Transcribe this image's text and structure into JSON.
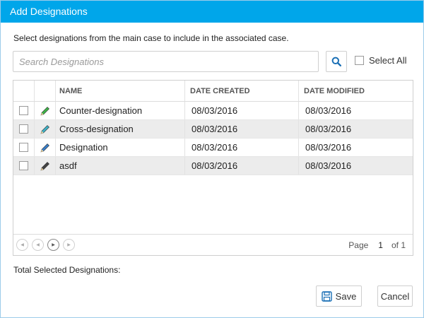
{
  "dialog": {
    "title": "Add Designations",
    "instructions": "Select designations from the main case to include in the associated case."
  },
  "search": {
    "placeholder": "Search Designations",
    "value": "",
    "button_icon": "search-icon",
    "select_all_label": "Select All",
    "select_all_checked": false
  },
  "grid": {
    "columns": [
      "NAME",
      "DATE CREATED",
      "DATE MODIFIED"
    ],
    "rows": [
      {
        "checked": false,
        "icon": "pencil-icon",
        "icon_color": "#3fb54a",
        "name": "Counter-designation",
        "created": "08/03/2016",
        "modified": "08/03/2016"
      },
      {
        "checked": false,
        "icon": "pencil-icon",
        "icon_color": "#3fb3c8",
        "name": "Cross-designation",
        "created": "08/03/2016",
        "modified": "08/03/2016"
      },
      {
        "checked": false,
        "icon": "pencil-icon",
        "icon_color": "#3a7fc9",
        "name": "Designation",
        "created": "08/03/2016",
        "modified": "08/03/2016"
      },
      {
        "checked": false,
        "icon": "pencil-icon",
        "icon_color": "#444444",
        "name": "asdf",
        "created": "08/03/2016",
        "modified": "08/03/2016"
      }
    ],
    "pager": {
      "page_label": "Page",
      "current_page": "1",
      "of_label": "of 1"
    }
  },
  "footer": {
    "total_label": "Total Selected Designations:",
    "save_label": "Save",
    "cancel_label": "Cancel"
  },
  "colors": {
    "title_bar": "#00a6ea",
    "accent": "#1a6fb5",
    "row_alt": "#ececec"
  }
}
